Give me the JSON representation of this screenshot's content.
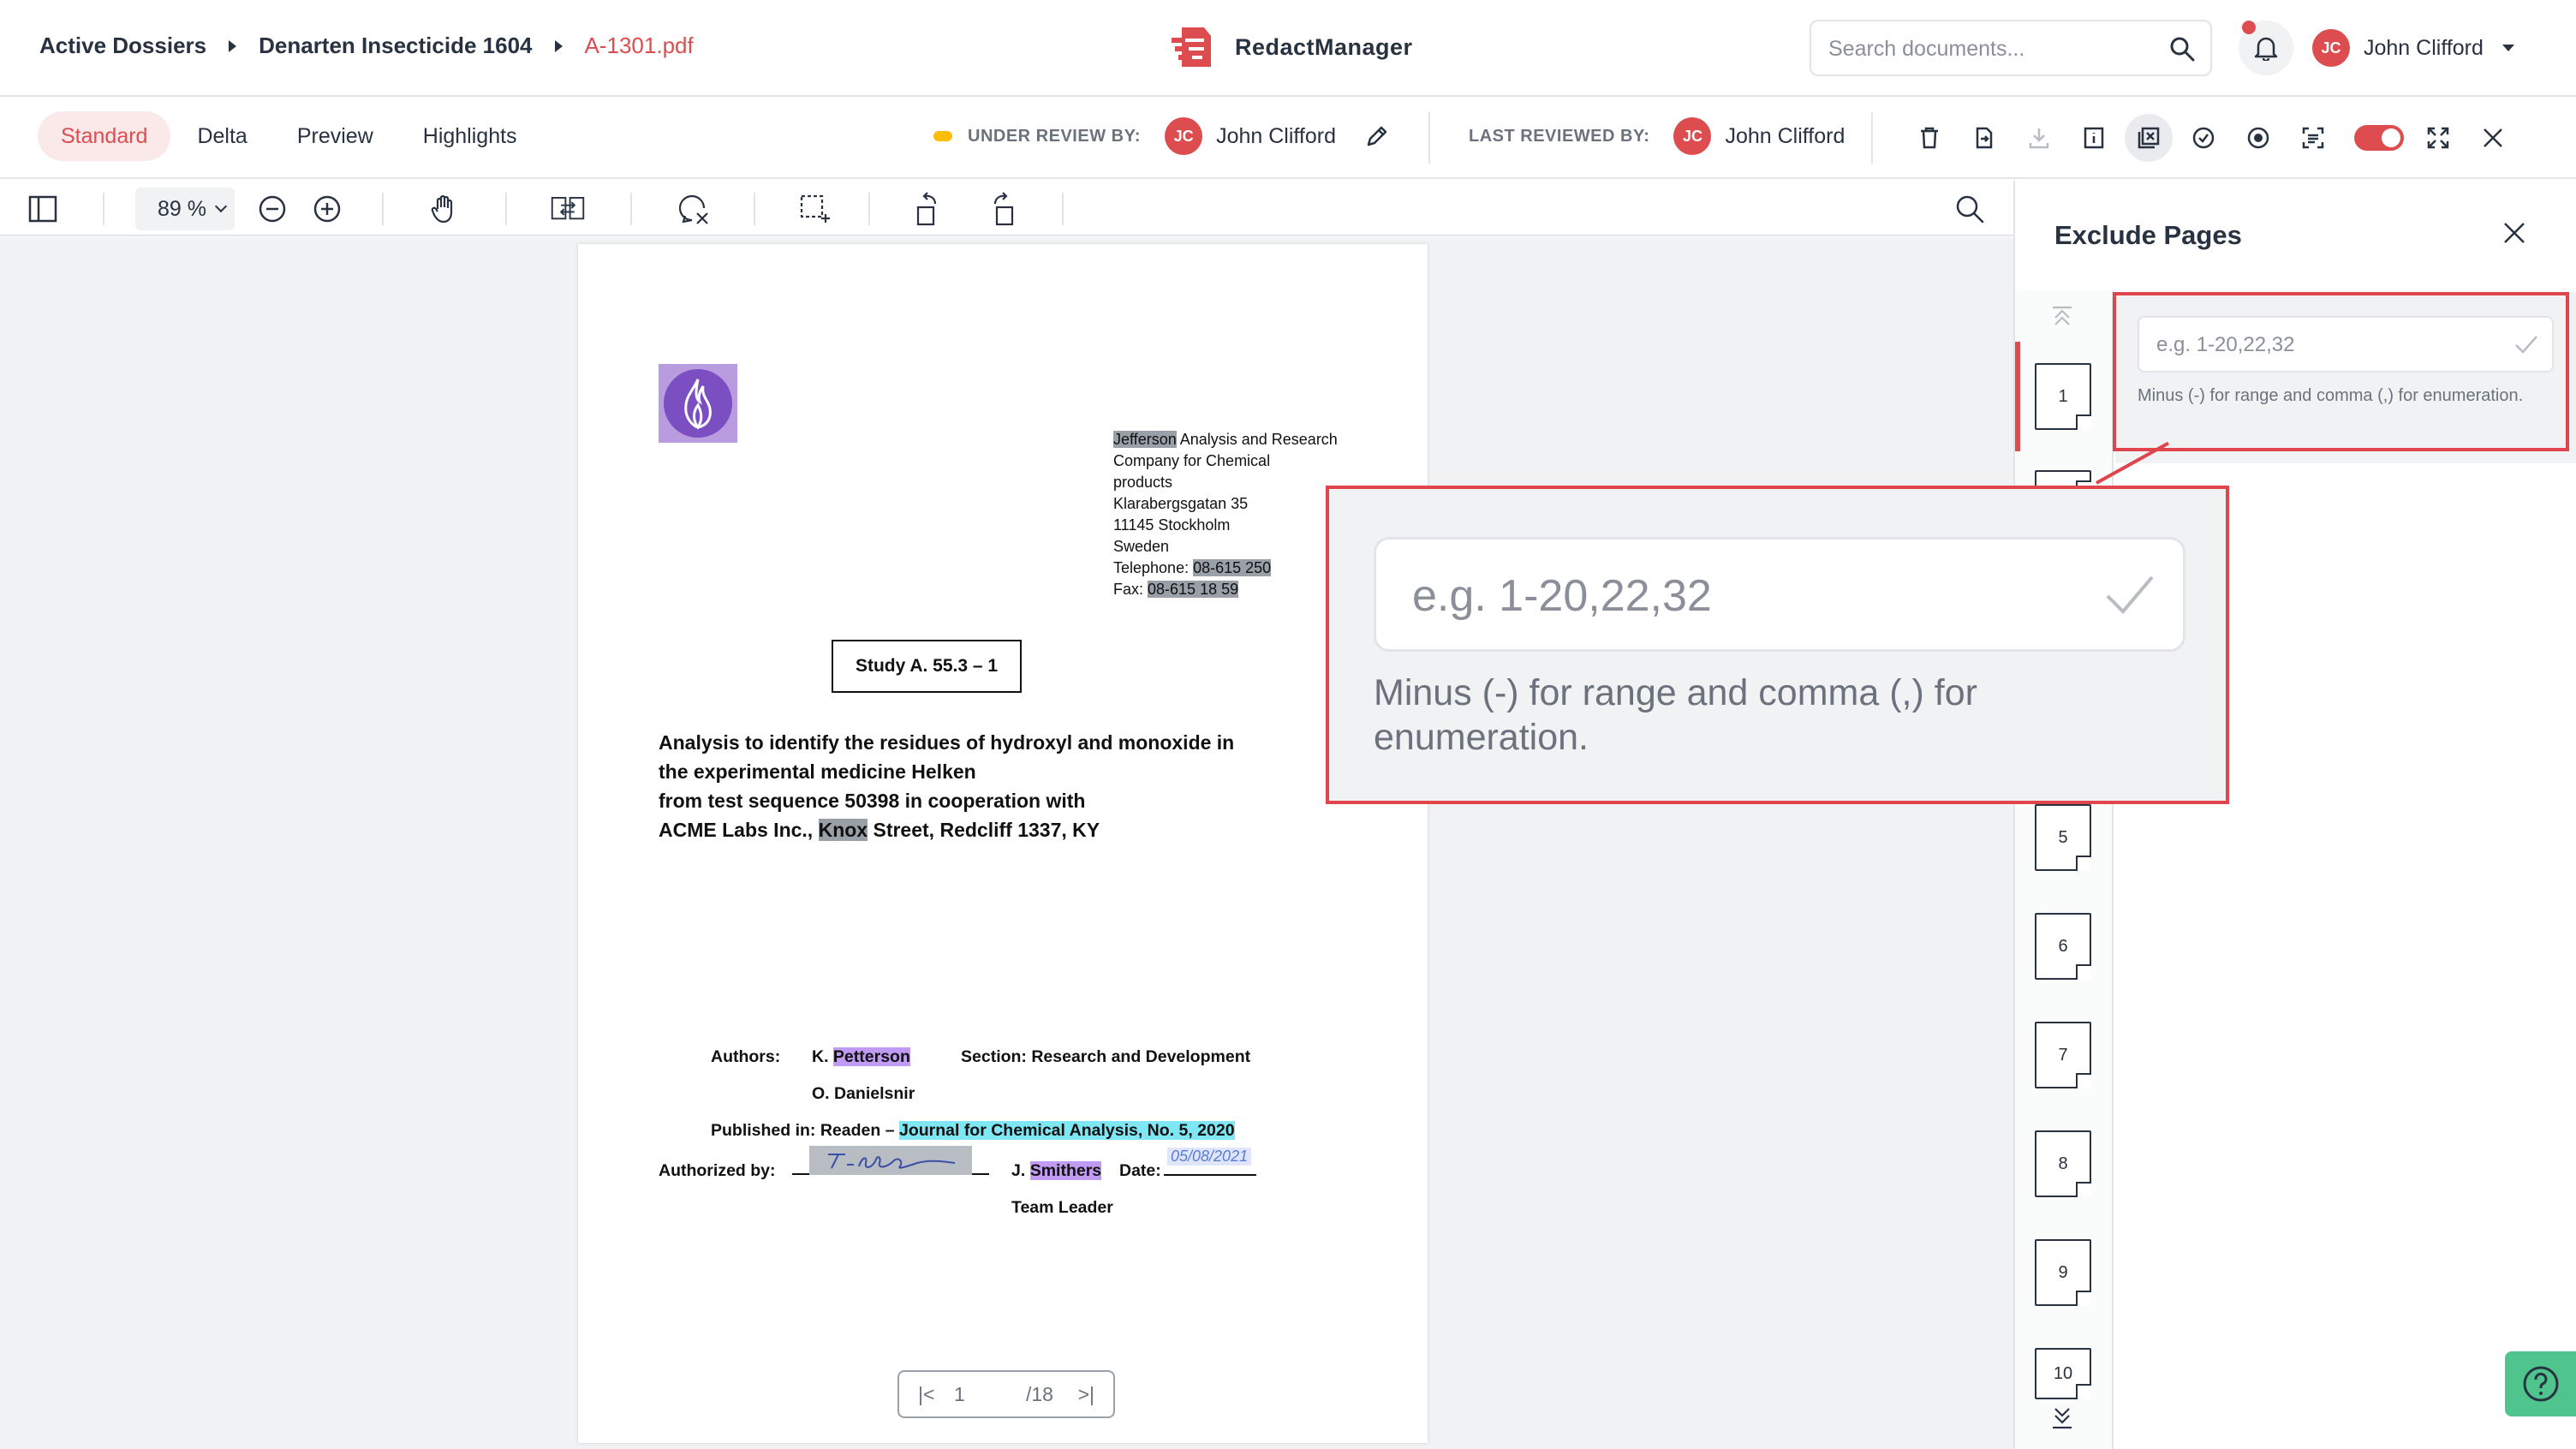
{
  "header": {
    "breadcrumb": [
      "Active Dossiers",
      "Denarten Insecticide 1604",
      "A-1301.pdf"
    ],
    "app_name": "RedactManager",
    "search_placeholder": "Search documents...",
    "user_initials": "JC",
    "user_name": "John Clifford",
    "notification_unread": true
  },
  "subbar": {
    "tabs": [
      "Standard",
      "Delta",
      "Preview",
      "Highlights"
    ],
    "active_tab": "Standard",
    "under_review_label": "UNDER REVIEW BY:",
    "under_review_initials": "JC",
    "under_review_name": "John Clifford",
    "last_reviewed_label": "LAST REVIEWED BY:",
    "last_reviewed_initials": "JC",
    "last_reviewed_name": "John Clifford",
    "toggle_on": true
  },
  "viewer_toolbar": {
    "zoom": "89 %"
  },
  "document": {
    "address": {
      "company_redacted": "Jefferson",
      "company_rest_1": " Analysis and Research",
      "company_rest_2": "Company for Chemical",
      "company_rest_3": "products",
      "street": "Klarabergsgatan 35",
      "city": "11145 Stockholm",
      "country": "Sweden",
      "telephone_label": "Telephone: ",
      "telephone": "08-615 250",
      "fax_label": "Fax: ",
      "fax": "08-615 18 59"
    },
    "study_label": "Study A. 55.3 – 1",
    "title_line1": "Analysis to identify the residues of hydroxyl and monoxide in",
    "title_line2": "the experimental medicine Helken",
    "title_line3": "from test sequence 50398 in cooperation with",
    "title_line4_a": "ACME Labs Inc., ",
    "title_line4_redacted": "Knox",
    "title_line4_b": " Street, Redcliff 1337, KY",
    "authors_label": "Authors:",
    "author1_prefix": "K. ",
    "author1_name": "Petterson",
    "section": "Section: Research and Development",
    "author2": "O. Danielsnir",
    "published_prefix": "Published in: Readen – ",
    "published_journal": "Journal for Chemical Analysis, No. 5, 2020",
    "authorized_label": "Authorized by:",
    "signature_text": "J. Smithers",
    "signer_prefix": "J. ",
    "signer_name": "Smithers",
    "date_label": "Date:",
    "date_value": "05/08/2021",
    "role": "Team Leader"
  },
  "pager": {
    "current": "1",
    "total": "/18"
  },
  "panel": {
    "title": "Exclude Pages",
    "input_placeholder": "e.g. 1-20,22,32",
    "hint": "Minus (-) for range and comma (,) for enumeration.",
    "thumbnails": [
      "1",
      "5",
      "6",
      "7",
      "8",
      "9",
      "10"
    ],
    "active_page": "1"
  },
  "callout": {
    "input_placeholder": "e.g. 1-20,22,32",
    "hint": "Minus (-) for range and comma (,) for enumeration."
  },
  "colors": {
    "accent": "#dd4d50",
    "callout_border": "#e0454d",
    "review_status": "#fdbd00",
    "help_button": "#4fc48d"
  }
}
